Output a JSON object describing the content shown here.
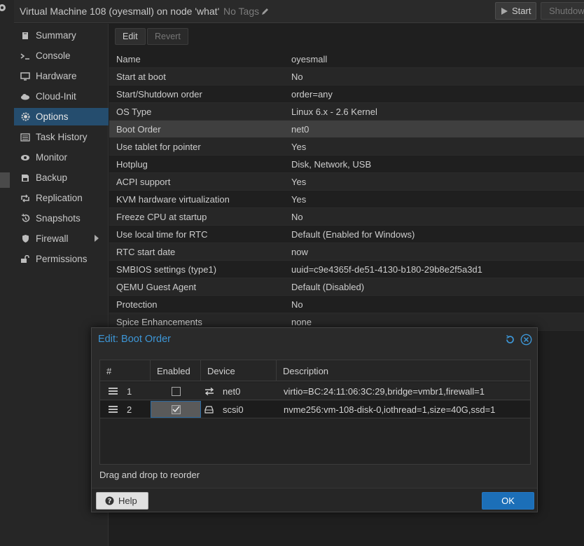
{
  "header": {
    "title": "Virtual Machine 108 (oyesmall) on node 'what'",
    "tags": "No Tags",
    "start_label": "Start",
    "shutdown_label": "Shutdown"
  },
  "sidebar": {
    "items": [
      {
        "label": "Summary",
        "icon": "book-icon"
      },
      {
        "label": "Console",
        "icon": "terminal-icon"
      },
      {
        "label": "Hardware",
        "icon": "monitor-icon"
      },
      {
        "label": "Cloud-Init",
        "icon": "cloud-icon"
      },
      {
        "label": "Options",
        "icon": "gear-icon",
        "active": true
      },
      {
        "label": "Task History",
        "icon": "list-icon"
      },
      {
        "label": "Monitor",
        "icon": "eye-icon"
      },
      {
        "label": "Backup",
        "icon": "floppy-icon"
      },
      {
        "label": "Replication",
        "icon": "retweet-icon"
      },
      {
        "label": "Snapshots",
        "icon": "history-icon"
      },
      {
        "label": "Firewall",
        "icon": "shield-icon"
      },
      {
        "label": "Permissions",
        "icon": "unlock-icon"
      }
    ]
  },
  "toolbar": {
    "edit_label": "Edit",
    "revert_label": "Revert"
  },
  "options": [
    {
      "key": "Name",
      "value": "oyesmall"
    },
    {
      "key": "Start at boot",
      "value": "No"
    },
    {
      "key": "Start/Shutdown order",
      "value": "order=any"
    },
    {
      "key": "OS Type",
      "value": "Linux 6.x - 2.6 Kernel"
    },
    {
      "key": "Boot Order",
      "value": "net0"
    },
    {
      "key": "Use tablet for pointer",
      "value": "Yes"
    },
    {
      "key": "Hotplug",
      "value": "Disk, Network, USB"
    },
    {
      "key": "ACPI support",
      "value": "Yes"
    },
    {
      "key": "KVM hardware virtualization",
      "value": "Yes"
    },
    {
      "key": "Freeze CPU at startup",
      "value": "No"
    },
    {
      "key": "Use local time for RTC",
      "value": "Default (Enabled for Windows)"
    },
    {
      "key": "RTC start date",
      "value": "now"
    },
    {
      "key": "SMBIOS settings (type1)",
      "value": "uuid=c9e4365f-de51-4130-b180-29b8e2f5a3d1"
    },
    {
      "key": "QEMU Guest Agent",
      "value": "Default (Disabled)"
    },
    {
      "key": "Protection",
      "value": "No"
    },
    {
      "key": "Spice Enhancements",
      "value": "none"
    }
  ],
  "dialog": {
    "title": "Edit: Boot Order",
    "columns": [
      "#",
      "Enabled",
      "Device",
      "Description"
    ],
    "rows": [
      {
        "num": "1",
        "enabled": false,
        "device": "net0",
        "device_icon": "exchange-icon",
        "description": "virtio=BC:24:11:06:3C:29,bridge=vmbr1,firewall=1"
      },
      {
        "num": "2",
        "enabled": true,
        "device": "scsi0",
        "device_icon": "hdd-icon",
        "description": "nvme256:vm-108-disk-0,iothread=1,size=40G,ssd=1"
      }
    ],
    "hint": "Drag and drop to reorder",
    "help_label": "Help",
    "ok_label": "OK"
  },
  "colors": {
    "accent": "#3d96d6",
    "selected": "#254d6e",
    "ok_button": "#1c6fb8"
  }
}
